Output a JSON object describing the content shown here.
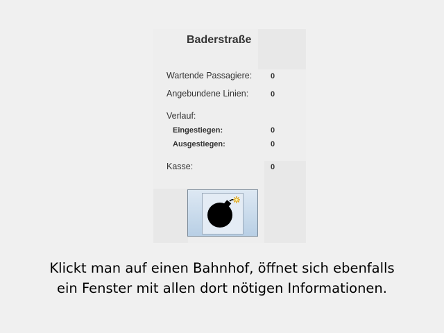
{
  "station": {
    "name": "Baderstraße",
    "waiting_passengers_label": "Wartende Passagiere:",
    "waiting_passengers_value": "0",
    "connected_lines_label": "Angebundene Linien:",
    "connected_lines_value": "0",
    "history_label": "Verlauf:",
    "boarded_label": "Eingestiegen:",
    "boarded_value": "0",
    "alighted_label": "Ausgestiegen:",
    "alighted_value": "0",
    "cash_label": "Kasse:",
    "cash_value": "0"
  },
  "bomb_button": {
    "icon": "bomb-icon"
  },
  "caption": {
    "line1": "Klickt man auf einen Bahnhof, öffnet sich ebenfalls",
    "line2": "ein Fenster mit allen dort nötigen Informationen."
  }
}
